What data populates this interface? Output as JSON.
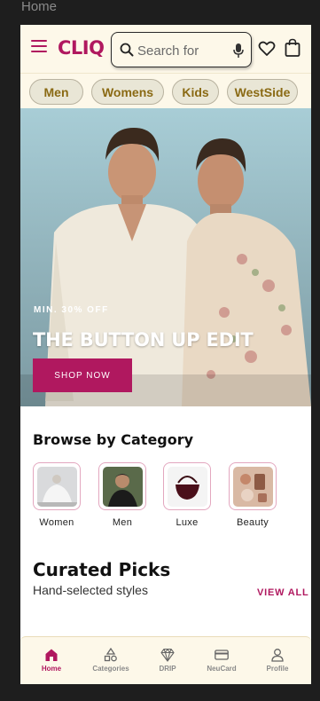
{
  "frame_label": "Home",
  "header": {
    "logo": "CLIQ",
    "search_placeholder": "Search for",
    "icons": [
      "menu-icon",
      "search-icon",
      "mic-icon",
      "heart-icon",
      "bag-icon"
    ]
  },
  "category_chips": [
    "Men",
    "Womens",
    "Kids",
    "WestSide"
  ],
  "banner": {
    "subtitle": "MIN. 30% OFF",
    "title": "THE BUTTON UP EDIT",
    "cta": "SHOP NOW"
  },
  "browse": {
    "title": "Browse by Category",
    "items": [
      {
        "label": "Women"
      },
      {
        "label": "Men"
      },
      {
        "label": "Luxe"
      },
      {
        "label": "Beauty"
      }
    ]
  },
  "curated": {
    "title": "Curated Picks",
    "subtitle": "Hand-selected styles",
    "view_all": "VIEW ALL"
  },
  "bottom_nav": [
    {
      "label": "Home",
      "icon": "home-icon",
      "active": true
    },
    {
      "label": "Categories",
      "icon": "categories-icon",
      "active": false
    },
    {
      "label": "DRIP",
      "icon": "diamond-icon",
      "active": false
    },
    {
      "label": "NeuCard",
      "icon": "card-icon",
      "active": false
    },
    {
      "label": "Profile",
      "icon": "profile-icon",
      "active": false
    }
  ],
  "colors": {
    "brand": "#b0185f",
    "header_bg": "#fdf8e9",
    "chip_bg": "#e9e6d6",
    "chip_text": "#8a6a14",
    "app_bg": "#1e1e1e"
  }
}
